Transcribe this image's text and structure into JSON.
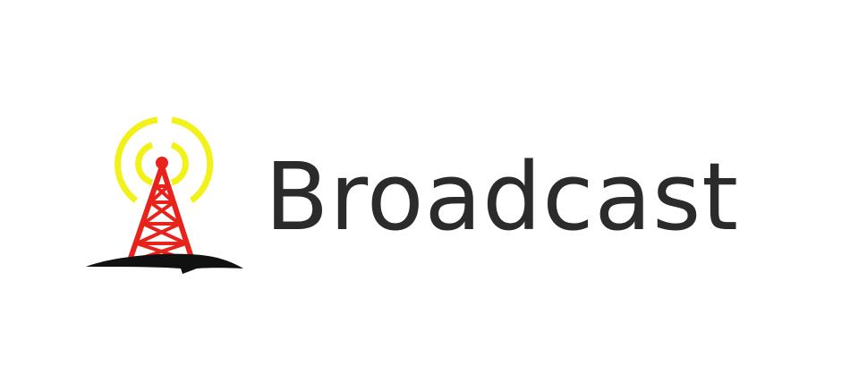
{
  "brand": {
    "name": "Broadcast",
    "icon": "radio-tower-icon"
  },
  "colors": {
    "background": "#ffffff",
    "text": "#2b2b2b",
    "tower": "#e8231c",
    "signal": "#f2f21a",
    "ground": "#111111"
  }
}
